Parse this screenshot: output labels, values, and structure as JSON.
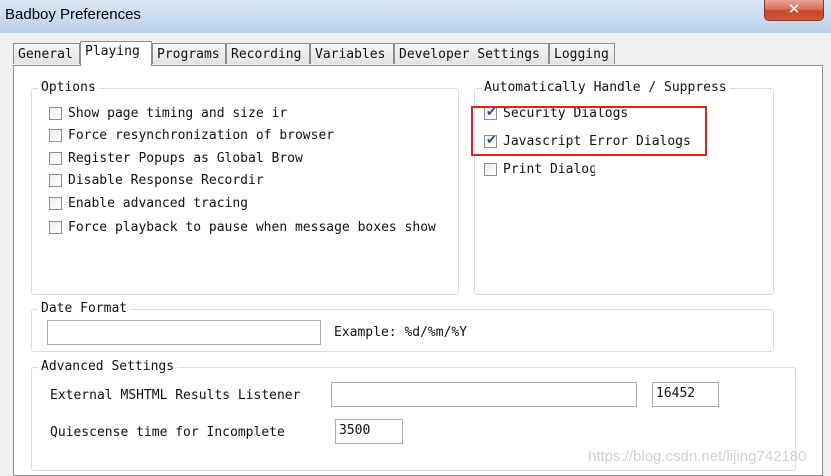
{
  "window": {
    "title": "Badboy Preferences",
    "close_glyph": "✕"
  },
  "tabs": [
    {
      "label": "General"
    },
    {
      "label": "Playing"
    },
    {
      "label": "Programs"
    },
    {
      "label": "Recording"
    },
    {
      "label": "Variables"
    },
    {
      "label": "Developer Settings"
    },
    {
      "label": "Logging"
    }
  ],
  "active_tab": "Playing",
  "options": {
    "legend": "Options",
    "items": [
      {
        "label": "Show page timing and size ir",
        "checked": false
      },
      {
        "label": "Force resynchronization of browser",
        "checked": false
      },
      {
        "label": "Register Popups as Global Brow",
        "checked": false
      },
      {
        "label": "Disable Response Recordir",
        "checked": false
      },
      {
        "label": "Enable advanced tracing",
        "checked": false
      },
      {
        "label": "Force playback to pause when message boxes show",
        "checked": false
      }
    ]
  },
  "auto_handle": {
    "legend": "Automatically Handle / Suppress",
    "items": [
      {
        "label": "Security Dialogs",
        "checked": true
      },
      {
        "label": "Javascript Error Dialogs",
        "checked": true
      },
      {
        "label": "Print Dialoɡ",
        "checked": false
      }
    ]
  },
  "date_format": {
    "legend": "Date Format",
    "value": "",
    "example": "Example: %d/%m/%Y"
  },
  "advanced": {
    "legend": "Advanced Settings",
    "listener_label": "External MSHTML Results Listener",
    "listener_host": "",
    "listener_port": "16452",
    "quiescence_label": "Quiescense time for Incomplete",
    "quiescence_value": "3500"
  },
  "check_glyph": "✔",
  "highlight_color": "#e02020",
  "watermark": "https://blog.csdn.net/lijing742180"
}
